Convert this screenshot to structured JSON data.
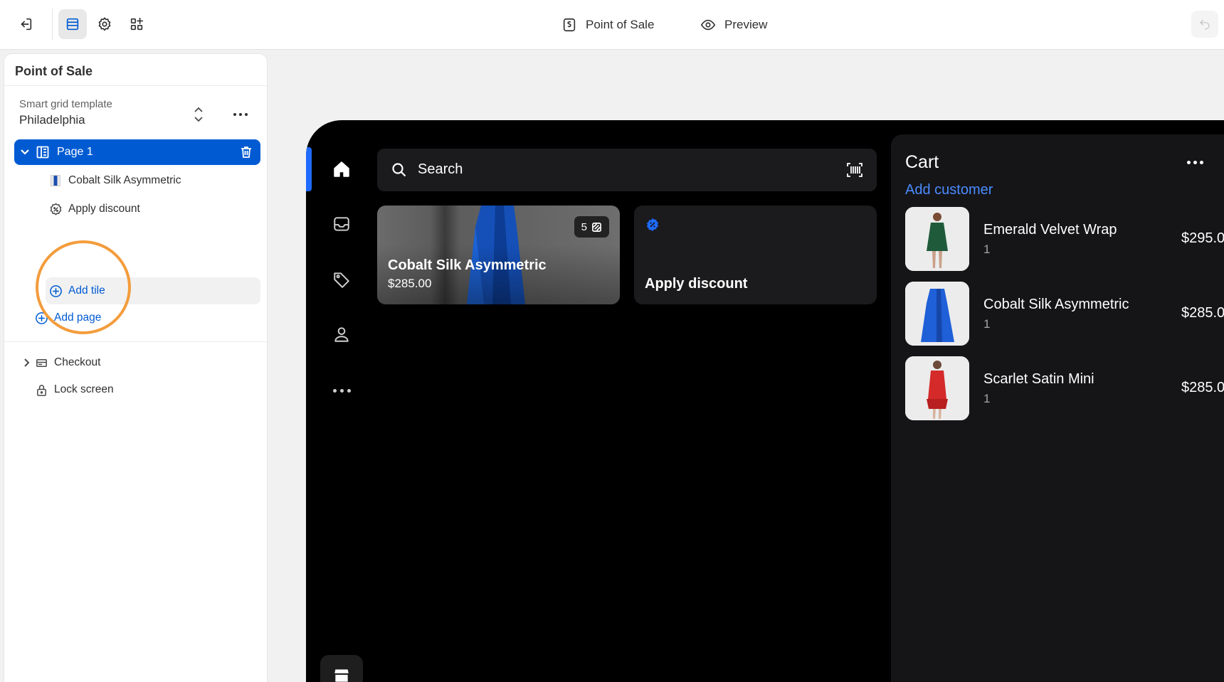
{
  "topbar": {
    "title": "Point of Sale",
    "preview_label": "Preview"
  },
  "panel": {
    "title": "Point of Sale",
    "template_label": "Smart grid template",
    "template_value": "Philadelphia",
    "page_label": "Page 1",
    "tiles": [
      {
        "label": "Cobalt Silk Asymmetric"
      },
      {
        "label": "Apply discount"
      }
    ],
    "add_tile_label": "Add tile",
    "add_page_label": "Add page",
    "checkout_label": "Checkout",
    "lock_screen_label": "Lock screen"
  },
  "pos": {
    "search_placeholder": "Search",
    "product_tile": {
      "name": "Cobalt Silk Asymmetric",
      "price": "$285.00",
      "variant_count": "5"
    },
    "discount_tile": {
      "name": "Apply discount"
    },
    "cart": {
      "title": "Cart",
      "add_customer_label": "Add customer",
      "items": [
        {
          "name": "Emerald Velvet Wrap",
          "qty": "1",
          "price": "$295.0",
          "color": "#1f5b3a"
        },
        {
          "name": "Cobalt Silk Asymmetric",
          "qty": "1",
          "price": "$285.0",
          "color": "#1f5fd8"
        },
        {
          "name": "Scarlet Satin Mini",
          "qty": "1",
          "price": "$285.0",
          "color": "#d42a2a"
        }
      ]
    }
  },
  "colors": {
    "accent": "#005bd3",
    "highlight_ring": "#f39c3c",
    "pos_link": "#4b8bff"
  }
}
